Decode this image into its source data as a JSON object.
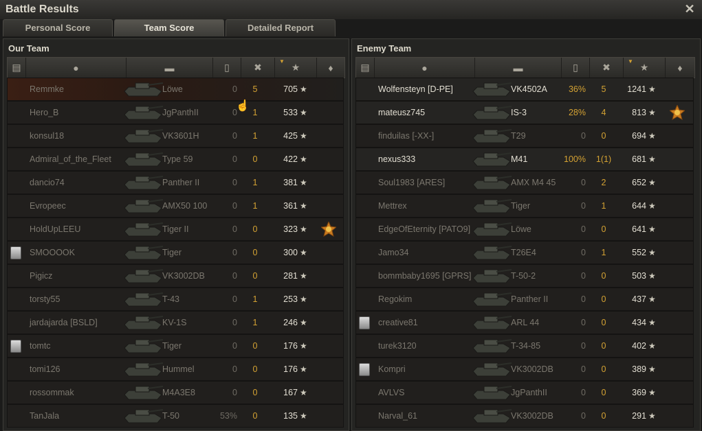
{
  "window": {
    "title": "Battle Results"
  },
  "tabs": [
    {
      "label": "Personal Score"
    },
    {
      "label": "Team Score"
    },
    {
      "label": "Detailed Report"
    }
  ],
  "active_tab": "Team Score",
  "colors": {
    "accent": "#d4a233",
    "highlight_row": "#3a1f14"
  },
  "our_team": {
    "title": "Our Team",
    "rows": [
      {
        "player": "Remmke",
        "vehicle": "Löwe",
        "survival": "0",
        "kills": "5",
        "xp": "705",
        "highlight": true
      },
      {
        "player": "Hero_B",
        "vehicle": "JgPanthII",
        "survival": "0",
        "kills": "1",
        "xp": "533"
      },
      {
        "player": "konsul18",
        "vehicle": "VK3601H",
        "survival": "0",
        "kills": "1",
        "xp": "425"
      },
      {
        "player": "Admiral_of_the_Fleet",
        "vehicle": "Type 59",
        "survival": "0",
        "kills": "0",
        "xp": "422"
      },
      {
        "player": "dancio74",
        "vehicle": "Panther II",
        "survival": "0",
        "kills": "1",
        "xp": "381"
      },
      {
        "player": "Evropeec",
        "vehicle": "AMX50 100",
        "survival": "0",
        "kills": "1",
        "xp": "361"
      },
      {
        "player": "HoldUpLEEU",
        "vehicle": "Tiger II",
        "survival": "0",
        "kills": "0",
        "xp": "323",
        "medal": true
      },
      {
        "player": "SMOOOOK",
        "vehicle": "Tiger",
        "survival": "0",
        "kills": "0",
        "xp": "300",
        "badge": true
      },
      {
        "player": "Pigicz",
        "vehicle": "VK3002DB",
        "survival": "0",
        "kills": "0",
        "xp": "281"
      },
      {
        "player": "torsty55",
        "vehicle": "T-43",
        "survival": "0",
        "kills": "1",
        "xp": "253"
      },
      {
        "player": "jardajarda [BSLD]",
        "vehicle": "KV-1S",
        "survival": "0",
        "kills": "1",
        "xp": "246"
      },
      {
        "player": "tomtc",
        "vehicle": "Tiger",
        "survival": "0",
        "kills": "0",
        "xp": "176",
        "badge": true
      },
      {
        "player": "tomi126",
        "vehicle": "Hummel",
        "survival": "0",
        "kills": "0",
        "xp": "176"
      },
      {
        "player": "rossommak",
        "vehicle": "M4A3E8",
        "survival": "0",
        "kills": "0",
        "xp": "167"
      },
      {
        "player": "TanJala",
        "vehicle": "T-50",
        "survival": "53%",
        "kills": "0",
        "xp": "135"
      }
    ]
  },
  "enemy_team": {
    "title": "Enemy Team",
    "rows": [
      {
        "player": "Wolfensteyn [D-PE]",
        "vehicle": "VK4502A",
        "survival": "36%",
        "kills": "5",
        "xp": "1241",
        "alive": true
      },
      {
        "player": "mateusz745",
        "vehicle": "IS-3",
        "survival": "28%",
        "kills": "4",
        "xp": "813",
        "alive": true,
        "medal": true
      },
      {
        "player": "finduilas [-XX-]",
        "vehicle": "T29",
        "survival": "0",
        "kills": "0",
        "xp": "694"
      },
      {
        "player": "nexus333",
        "vehicle": "M41",
        "survival": "100%",
        "kills": "1(1)",
        "xp": "681",
        "alive": true
      },
      {
        "player": "Soul1983 [ARES]",
        "vehicle": "AMX M4 45",
        "survival": "0",
        "kills": "2",
        "xp": "652"
      },
      {
        "player": "Mettrex",
        "vehicle": "Tiger",
        "survival": "0",
        "kills": "1",
        "xp": "644"
      },
      {
        "player": "EdgeOfEternity [PATO9]",
        "vehicle": "Löwe",
        "survival": "0",
        "kills": "0",
        "xp": "641"
      },
      {
        "player": "Jamo34",
        "vehicle": "T26E4",
        "survival": "0",
        "kills": "1",
        "xp": "552"
      },
      {
        "player": "bommbaby1695 [GPRS]",
        "vehicle": "T-50-2",
        "survival": "0",
        "kills": "0",
        "xp": "503"
      },
      {
        "player": "Regokim",
        "vehicle": "Panther II",
        "survival": "0",
        "kills": "0",
        "xp": "437"
      },
      {
        "player": "creative81",
        "vehicle": "ARL 44",
        "survival": "0",
        "kills": "0",
        "xp": "434",
        "badge": true
      },
      {
        "player": "turek3120",
        "vehicle": "T-34-85",
        "survival": "0",
        "kills": "0",
        "xp": "402"
      },
      {
        "player": "Kompri",
        "vehicle": "VK3002DB",
        "survival": "0",
        "kills": "0",
        "xp": "389",
        "badge": true
      },
      {
        "player": "AVLVS",
        "vehicle": "JgPanthII",
        "survival": "0",
        "kills": "0",
        "xp": "369"
      },
      {
        "player": "Narval_61",
        "vehicle": "VK3002DB",
        "survival": "0",
        "kills": "0",
        "xp": "291"
      }
    ]
  }
}
